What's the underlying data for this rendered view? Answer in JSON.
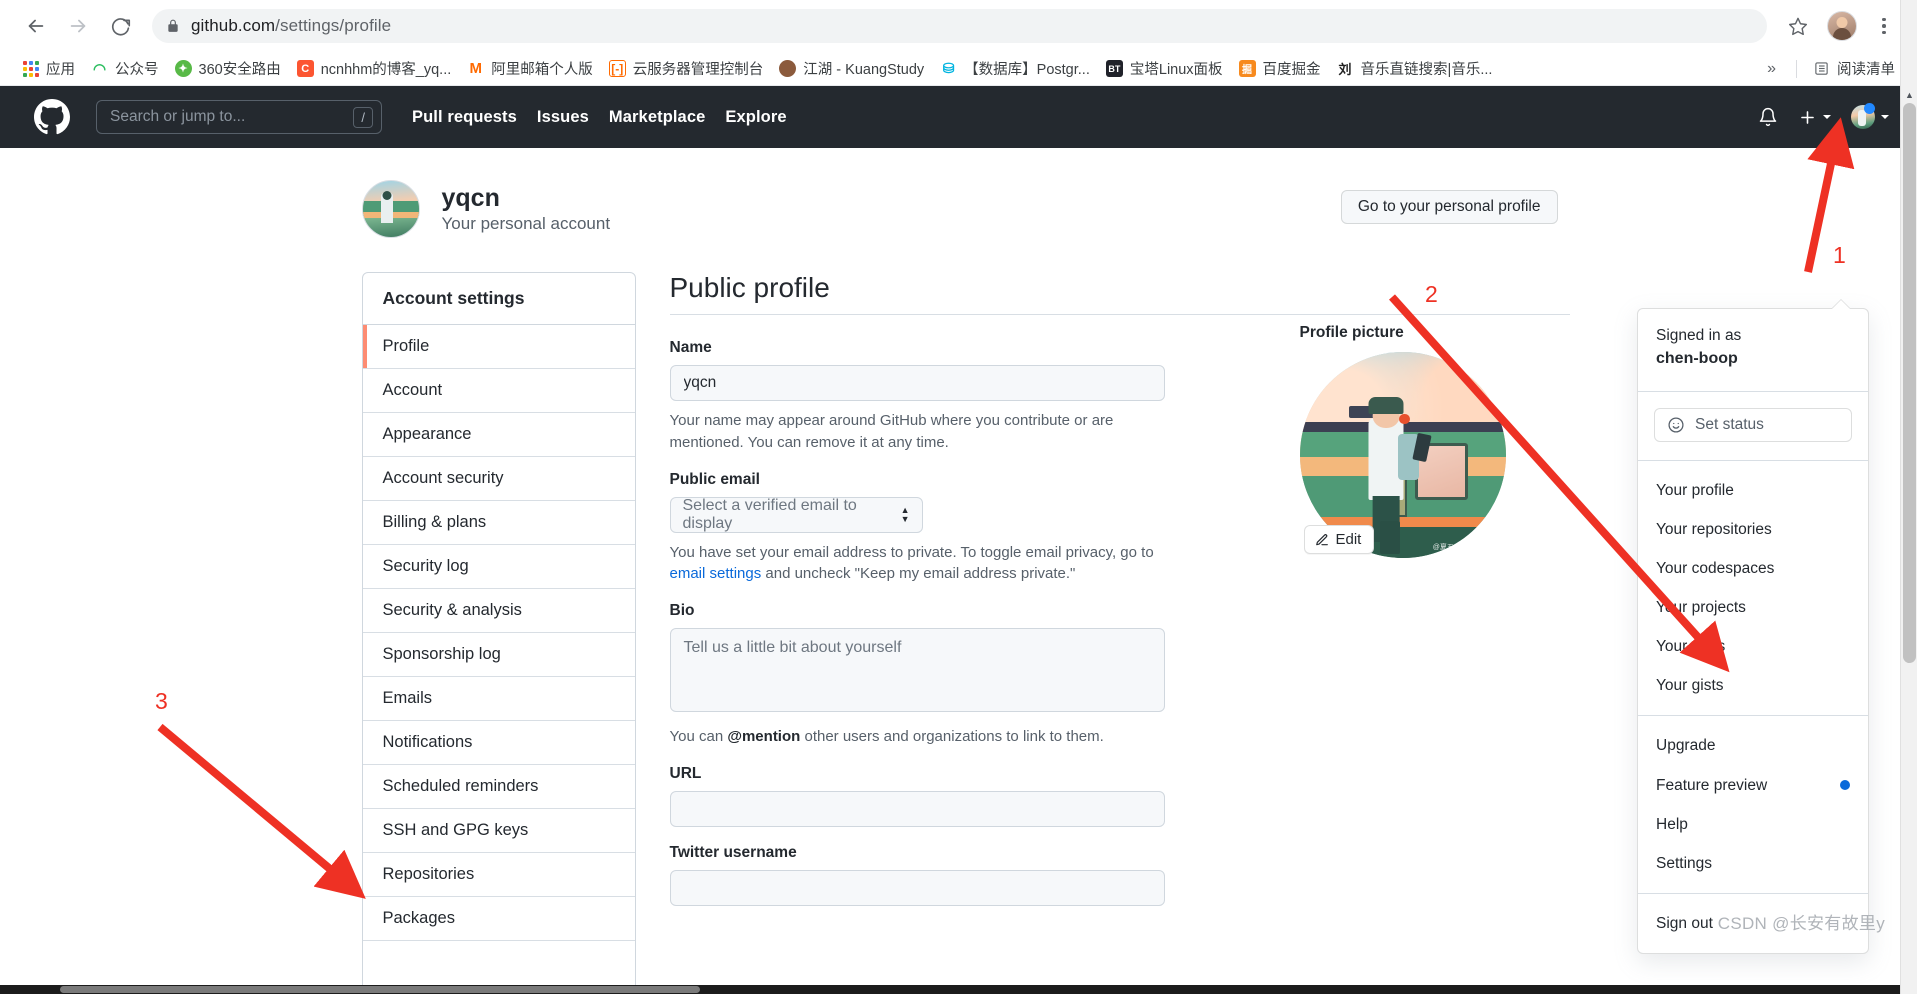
{
  "browser": {
    "url_bold": "github.com",
    "url_dim": "/settings/profile",
    "back_icon": "back-arrow-icon",
    "forward_icon": "forward-arrow-icon",
    "reload_icon": "reload-icon",
    "lock_icon": "lock-icon",
    "star_icon": "star-icon",
    "menu_icon": "kebab-menu-icon",
    "bookmarks": [
      {
        "label": "应用",
        "icon": "apps-grid-icon"
      },
      {
        "label": "公众号",
        "icon": "wechat-official-icon"
      },
      {
        "label": "360安全路由",
        "icon": "360-icon"
      },
      {
        "label": "ncnhhm的博客_yq...",
        "icon": "csdn-icon"
      },
      {
        "label": "阿里邮箱个人版",
        "icon": "mail-icon"
      },
      {
        "label": "云服务器管理控制台",
        "icon": "aliyun-icon"
      },
      {
        "label": "江湖 - KuangStudy",
        "icon": "kuangstudy-icon"
      },
      {
        "label": "【数据库】Postgr...",
        "icon": "database-icon"
      },
      {
        "label": "宝塔Linux面板",
        "icon": "bt-panel-icon"
      },
      {
        "label": "百度掘金",
        "icon": "juejin-icon"
      },
      {
        "label": "音乐直链搜索|音乐...",
        "icon": "music-icon"
      }
    ],
    "overflow_label": "»",
    "reading_list": {
      "label": "阅读清单",
      "icon": "reading-list-icon"
    }
  },
  "gh_header": {
    "logo_icon": "github-mark-icon",
    "search_placeholder": "Search or jump to...",
    "search_value": "",
    "slash_key": "/",
    "nav": [
      {
        "label": "Pull requests"
      },
      {
        "label": "Issues"
      },
      {
        "label": "Marketplace"
      },
      {
        "label": "Explore"
      }
    ],
    "bell_icon": "bell-icon",
    "plus_icon": "plus-icon",
    "avatar_icon": "user-avatar-icon"
  },
  "account_header": {
    "name": "yqcn",
    "subtitle": "Your personal account",
    "go_profile_button": "Go to your personal profile"
  },
  "sidebar": {
    "title": "Account settings",
    "items": [
      {
        "label": "Profile",
        "active": true
      },
      {
        "label": "Account",
        "active": false
      },
      {
        "label": "Appearance",
        "active": false
      },
      {
        "label": "Account security",
        "active": false
      },
      {
        "label": "Billing & plans",
        "active": false
      },
      {
        "label": "Security log",
        "active": false
      },
      {
        "label": "Security & analysis",
        "active": false
      },
      {
        "label": "Sponsorship log",
        "active": false
      },
      {
        "label": "Emails",
        "active": false
      },
      {
        "label": "Notifications",
        "active": false
      },
      {
        "label": "Scheduled reminders",
        "active": false
      },
      {
        "label": "SSH and GPG keys",
        "active": false
      },
      {
        "label": "Repositories",
        "active": false
      },
      {
        "label": "Packages",
        "active": false
      }
    ]
  },
  "main": {
    "title": "Public profile",
    "name_label": "Name",
    "name_value": "yqcn",
    "name_help_1": "Your name may appear around GitHub where you contribute or are mentioned. You can",
    "name_help_2": "remove it at any time.",
    "email_label": "Public email",
    "email_select_value": "Select a verified email to display",
    "email_help_1": "You have set your email address to private. To toggle email privacy, go to ",
    "email_help_link": "email settings",
    "email_help_2": "and uncheck \"Keep my email address private.\"",
    "bio_label": "Bio",
    "bio_placeholder": "Tell us a little bit about yourself",
    "bio_value": "",
    "bio_help_pre": "You can ",
    "bio_help_mention": "@mention",
    "bio_help_post": " other users and organizations to link to them.",
    "url_label": "URL",
    "url_value": "",
    "twitter_label": "Twitter username",
    "twitter_value": ""
  },
  "profile_picture": {
    "title": "Profile picture",
    "edit_label": "Edit",
    "edit_icon": "pencil-icon",
    "credit": "@夏五sunny"
  },
  "user_menu": {
    "signed_in_as": "Signed in as",
    "username": "chen-boop",
    "status_label": "Set status",
    "status_icon": "smiley-icon",
    "group_1": [
      {
        "label": "Your profile"
      },
      {
        "label": "Your repositories"
      },
      {
        "label": "Your codespaces"
      },
      {
        "label": "Your projects"
      },
      {
        "label": "Your stars"
      },
      {
        "label": "Your gists"
      }
    ],
    "group_2": [
      {
        "label": "Upgrade",
        "dot": false
      },
      {
        "label": "Feature preview",
        "dot": true
      },
      {
        "label": "Help",
        "dot": false
      },
      {
        "label": "Settings",
        "dot": false
      }
    ],
    "group_3": [
      {
        "label": "Sign out"
      }
    ]
  },
  "annotations": [
    {
      "num": "1"
    },
    {
      "num": "2"
    },
    {
      "num": "3"
    }
  ],
  "watermark": "CSDN @长安有故里y",
  "colors": {
    "gh_header_bg": "#24292f",
    "accent_orange": "#fd8c73",
    "link_blue": "#0969da",
    "annotation_red": "#ee3124"
  }
}
